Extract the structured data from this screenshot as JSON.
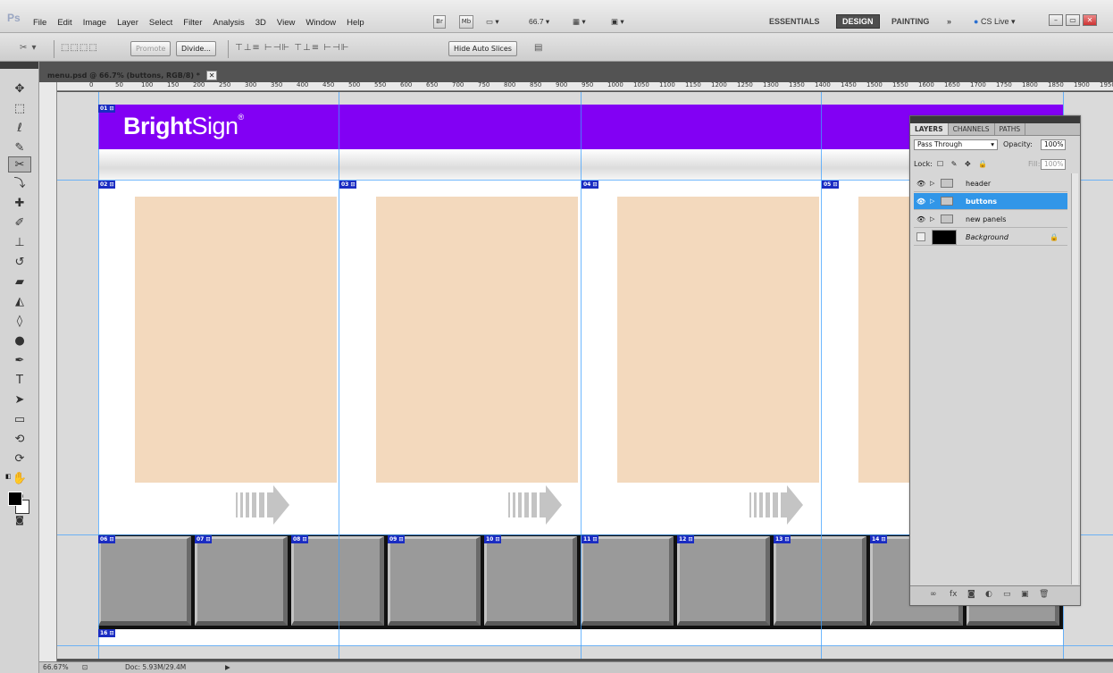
{
  "app": {
    "logo": "Ps"
  },
  "menus": [
    "File",
    "Edit",
    "Image",
    "Layer",
    "Select",
    "Filter",
    "Analysis",
    "3D",
    "View",
    "Window",
    "Help"
  ],
  "appbar": {
    "bridge_label": "Br",
    "minibridge_label": "Mb",
    "zoom_value": "66.7",
    "workspaces": [
      "ESSENTIALS",
      "DESIGN",
      "PAINTING"
    ],
    "active_workspace": "DESIGN",
    "more_label": "»",
    "cslive_label": "CS Live"
  },
  "options_bar": {
    "promote_label": "Promote",
    "divide_label": "Divide...",
    "hide_auto_slices_label": "Hide Auto Slices"
  },
  "document": {
    "tab_title": "menu.psd @ 66.7% (buttons, RGB/8) *",
    "ruler_ticks": [
      "0",
      "50",
      "100",
      "150",
      "200",
      "250",
      "300",
      "350",
      "400",
      "450",
      "500",
      "550",
      "600",
      "650",
      "700",
      "750",
      "800",
      "850",
      "900",
      "950",
      "1000",
      "1050",
      "1100",
      "1150",
      "1200",
      "1250",
      "1300",
      "1350",
      "1400",
      "1450",
      "1500",
      "1550",
      "1600",
      "1650",
      "1700",
      "1750",
      "1800",
      "1850",
      "1900",
      "1950"
    ],
    "brand": {
      "bright": "Bright",
      "sign": "Sign",
      "reg": "®"
    },
    "slices": [
      "01",
      "02",
      "03",
      "04",
      "05",
      "06",
      "07",
      "08",
      "09",
      "10",
      "11",
      "12",
      "13",
      "14",
      "16"
    ]
  },
  "layers_panel": {
    "tabs": [
      "LAYERS",
      "CHANNELS",
      "PATHS"
    ],
    "active_tab": "LAYERS",
    "blend_mode": "Pass Through",
    "opacity_label": "Opacity:",
    "opacity_value": "100%",
    "lock_label": "Lock:",
    "fill_label": "Fill:",
    "fill_value": "100%",
    "layers": [
      {
        "name": "header",
        "type": "group",
        "visible": true,
        "selected": false
      },
      {
        "name": "buttons",
        "type": "group",
        "visible": true,
        "selected": true
      },
      {
        "name": "new panels",
        "type": "group",
        "visible": true,
        "selected": false
      },
      {
        "name": "Background",
        "type": "background",
        "visible": false,
        "selected": false
      }
    ]
  },
  "status": {
    "zoom": "66.67%",
    "doc_size": "Doc: 5.93M/29.4M"
  },
  "colors": {
    "header_purple": "#8200f4",
    "panel_peach": "#f3d9bd",
    "guide_blue": "#3da0ff",
    "slice_blue": "#1a2cc2",
    "layer_selected": "#3196e8"
  }
}
